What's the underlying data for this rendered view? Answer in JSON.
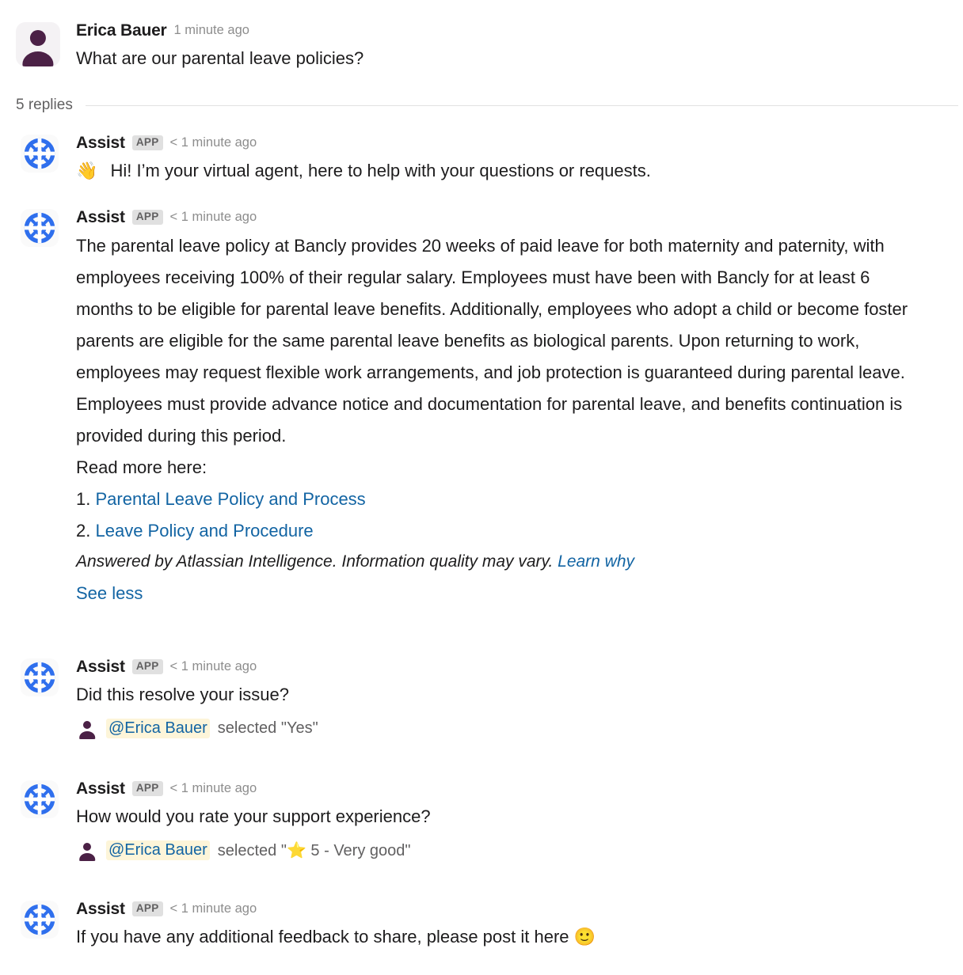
{
  "root_message": {
    "sender": "Erica Bauer",
    "timestamp": "1 minute ago",
    "text": "What are our parental leave policies?",
    "avatar_icon": "user-avatar-icon"
  },
  "thread": {
    "replies_label": "5 replies"
  },
  "colors": {
    "link_blue": "#1264a3",
    "app_avatar_blue": "#2f6fed",
    "mention_highlight": "#fdf5d9",
    "badge_bg": "#e0e0e0",
    "avatar_purple": "#4b2146",
    "divider": "#e2e2e2"
  },
  "replies": [
    {
      "sender": "Assist",
      "badge": "APP",
      "timestamp": "< 1 minute ago",
      "avatar_icon": "life-ring-icon",
      "emoji": "👋",
      "text": "Hi! I’m your virtual agent, here to help with your questions or requests."
    },
    {
      "sender": "Assist",
      "badge": "APP",
      "timestamp": "< 1 minute ago",
      "avatar_icon": "life-ring-icon",
      "answer": "The parental leave policy at Bancly provides 20 weeks of paid leave for both maternity and paternity, with employees receiving 100% of their regular salary. Employees must have been with Bancly for at least 6 months to be eligible for parental leave benefits. Additionally, employees who adopt a child or become foster parents are eligible for the same parental leave benefits as biological parents. Upon returning to work, employees may request flexible work arrangements, and job protection is guaranteed during parental leave. Employees must provide advance notice and documentation for parental leave, and benefits continuation is provided during this period.",
      "read_more_label": "Read more here:",
      "sources": [
        {
          "num": "1.",
          "label": "Parental Leave Policy and Process"
        },
        {
          "num": "2.",
          "label": "Leave Policy and Procedure"
        }
      ],
      "attribution_text": "Answered by Atlassian Intelligence. Information quality may vary.",
      "attribution_link": "Learn why",
      "see_less_label": "See less"
    },
    {
      "sender": "Assist",
      "badge": "APP",
      "timestamp": "< 1 minute ago",
      "avatar_icon": "life-ring-icon",
      "text": "Did this resolve your issue?",
      "selection": {
        "mention": "@Erica Bauer",
        "text": "selected \"Yes\"",
        "avatar_icon": "user-avatar-icon"
      }
    },
    {
      "sender": "Assist",
      "badge": "APP",
      "timestamp": "< 1 minute ago",
      "avatar_icon": "life-ring-icon",
      "text": "How would you rate your support experience?",
      "selection": {
        "mention": "@Erica Bauer",
        "text_before": "selected \"",
        "emoji": "⭐",
        "text_after": " 5 - Very good\"",
        "avatar_icon": "user-avatar-icon"
      }
    },
    {
      "sender": "Assist",
      "badge": "APP",
      "timestamp": "< 1 minute ago",
      "avatar_icon": "life-ring-icon",
      "text": "If you have any additional feedback to share, please post it here ",
      "trailing_emoji": "🙂"
    }
  ]
}
